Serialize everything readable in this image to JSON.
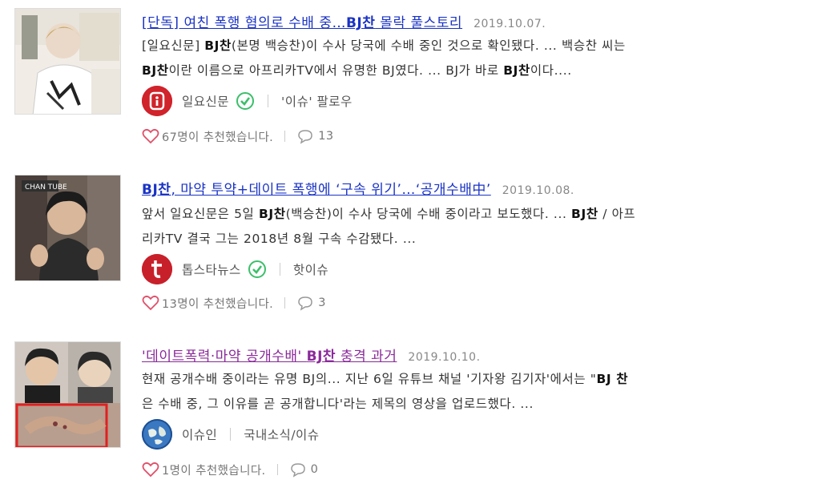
{
  "items": [
    {
      "title_parts": [
        "[단독] 여친 폭행 혐의로 수배 중…",
        "BJ찬",
        " 몰락 풀스토리"
      ],
      "date": "2019.10.07.",
      "desc_line1_parts": [
        "[일요신문] ",
        "BJ찬",
        "(본명 백승찬)이 수사 당국에 수배 중인 것으로 확인됐다. ... 백승찬 씨는"
      ],
      "desc_line2_parts": [
        "BJ찬",
        "이란 이름으로 아프리카TV에서 유명한 BJ였다. ... BJ가 바로 ",
        "BJ찬",
        "이다...."
      ],
      "source": "일요신문",
      "category": "'이슈' 팔로우",
      "recommend": "67명이 추천했습니다.",
      "comments": "13",
      "logo_color": "#d0232b"
    },
    {
      "title_parts": [
        "BJ찬",
        ", 마약 투약+데이트 폭행에 ‘구속 위기’…‘공개수배中’"
      ],
      "date": "2019.10.08.",
      "desc_line1_parts": [
        "앞서 일요신문은 5일 ",
        "BJ찬",
        "(백승찬)이 수사 당국에 수배 중이라고 보도했다. ... ",
        "BJ찬",
        " / 아프"
      ],
      "desc_line2_parts": [
        "리카TV 결국 그는 2018년 8월 구속 수감됐다. ..."
      ],
      "source": "톱스타뉴스",
      "category": "핫이슈",
      "recommend": "13명이 추천했습니다.",
      "comments": "3",
      "logo_color": "#c8202a"
    },
    {
      "title_parts": [
        "'데이트폭력·마약 공개수배' ",
        "BJ찬",
        " 충격 과거"
      ],
      "date": "2019.10.10.",
      "desc_line1_parts": [
        "현재 공개수배 중이라는 유명 BJ의... 지난 6일 유튜브 채널 '기자왕 김기자'에서는 \"",
        "BJ 찬"
      ],
      "desc_line2_parts": [
        "은 수배 중, 그 이유를 곧 공개합니다'라는 제목의 영상을 업로드했다. ..."
      ],
      "source": "이슈인",
      "category": "국내소식/이슈",
      "recommend": "1명이 추천했습니다.",
      "comments": "0",
      "logo_color": "#2a5b9e"
    }
  ],
  "colors": {
    "title_link": "#1a33c4",
    "title_visited": "#8a2a9a",
    "heart": "#e0506a",
    "check": "#3bbf6a"
  }
}
